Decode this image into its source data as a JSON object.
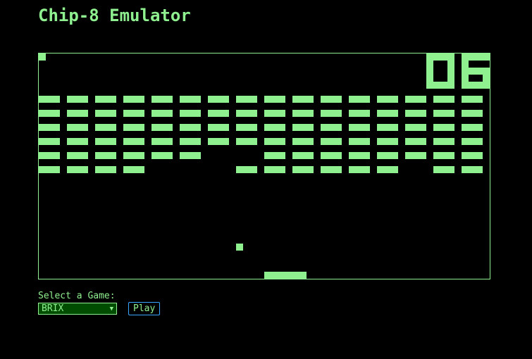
{
  "app": {
    "title": "Chip-8 Emulator"
  },
  "game": {
    "score": "06",
    "colors": {
      "pixel": "#8ff08f",
      "background": "#000000"
    },
    "brick_rows": [
      [
        1,
        1,
        1,
        1,
        1,
        1,
        1,
        1,
        1,
        1,
        1,
        1,
        1,
        1,
        1,
        1
      ],
      [
        1,
        1,
        1,
        1,
        1,
        1,
        1,
        1,
        1,
        1,
        1,
        1,
        1,
        1,
        1,
        1
      ],
      [
        1,
        1,
        1,
        1,
        1,
        1,
        1,
        1,
        1,
        1,
        1,
        1,
        1,
        1,
        1,
        1
      ],
      [
        1,
        1,
        1,
        1,
        1,
        1,
        1,
        1,
        1,
        1,
        1,
        1,
        1,
        1,
        1,
        1
      ],
      [
        1,
        1,
        1,
        1,
        1,
        1,
        0,
        0,
        1,
        1,
        1,
        1,
        1,
        1,
        1,
        1
      ],
      [
        1,
        1,
        1,
        1,
        0,
        0,
        0,
        1,
        1,
        1,
        1,
        1,
        1,
        0,
        1,
        1
      ]
    ]
  },
  "controls": {
    "select_label": "Select a Game:",
    "selected_game": "BRIX",
    "play_label": "Play"
  }
}
